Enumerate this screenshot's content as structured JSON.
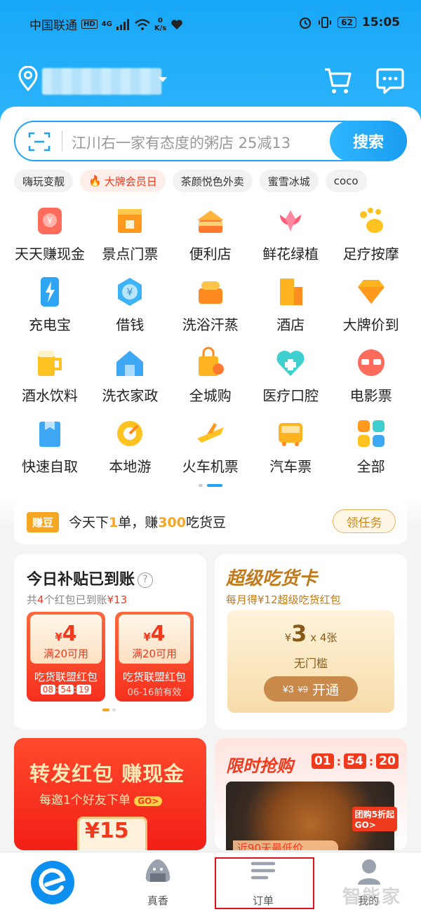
{
  "status": {
    "carrier": "中国联通",
    "hd": "HD",
    "network": "4G",
    "speed_value": "0",
    "speed_unit": "K/s",
    "battery": "62",
    "time": "15:05"
  },
  "search": {
    "placeholder": "江川右一家有态度的粥店 25减13",
    "button": "搜索"
  },
  "tags": [
    "嗨玩变靓",
    "大牌会员日",
    "茶颜悦色外卖",
    "蜜雪冰城",
    "coco"
  ],
  "grid": [
    {
      "label": "天天赚现金",
      "icon": "cash-icon"
    },
    {
      "label": "景点门票",
      "icon": "ticket-icon"
    },
    {
      "label": "便利店",
      "icon": "store-icon"
    },
    {
      "label": "鲜花绿植",
      "icon": "flower-icon"
    },
    {
      "label": "足疗按摩",
      "icon": "foot-icon"
    },
    {
      "label": "充电宝",
      "icon": "powerbank-icon"
    },
    {
      "label": "借钱",
      "icon": "loan-icon"
    },
    {
      "label": "洗浴汗蒸",
      "icon": "bath-icon"
    },
    {
      "label": "酒店",
      "icon": "hotel-icon"
    },
    {
      "label": "大牌价到",
      "icon": "diamond-icon"
    },
    {
      "label": "酒水饮料",
      "icon": "beer-icon"
    },
    {
      "label": "洗衣家政",
      "icon": "laundry-icon"
    },
    {
      "label": "全城购",
      "icon": "shopping-icon"
    },
    {
      "label": "医疗口腔",
      "icon": "medical-icon"
    },
    {
      "label": "电影票",
      "icon": "movie-icon"
    },
    {
      "label": "快速自取",
      "icon": "pickup-icon"
    },
    {
      "label": "本地游",
      "icon": "travel-icon"
    },
    {
      "label": "火车机票",
      "icon": "plane-icon"
    },
    {
      "label": "汽车票",
      "icon": "bus-icon"
    },
    {
      "label": "全部",
      "icon": "all-icon"
    }
  ],
  "task": {
    "badge": "赚豆",
    "t1": "今天下",
    "n1": "1",
    "t2": "单，赚",
    "n2": "300",
    "t3": "吃货豆",
    "button": "领任务"
  },
  "subsidy": {
    "title": "今日补贴已到账",
    "sub_prefix": "共",
    "sub_count": "4",
    "sub_mid": "个红包已到账",
    "sub_amount": "¥13",
    "packets": [
      {
        "currency": "¥",
        "amount": "4",
        "cond": "满20可用",
        "name": "吃货联盟红包",
        "h": "08",
        "m": "54",
        "s": "19"
      },
      {
        "currency": "¥",
        "amount": "4",
        "cond": "满20可用",
        "name": "吃货联盟红包",
        "expire": "06-16前有效"
      }
    ]
  },
  "supercard": {
    "title": "超级吃货卡",
    "sub": "每月得¥12超级吃货红包",
    "currency": "¥",
    "amount": "3",
    "times": "x",
    "count": "4张",
    "threshold": "无门槛",
    "btn_old": "¥9",
    "btn_label": "开通"
  },
  "share": {
    "title": "转发红包 赚现金",
    "sub": "每邀1个好友下单",
    "go": "GO>",
    "amount": "¥15"
  },
  "flash": {
    "title": "限时抢购",
    "h": "01",
    "m": "54",
    "s": "20",
    "badge": "团购5折起",
    "badge_go": "GO>",
    "banner": "近90天最低价"
  },
  "tabbar": [
    {
      "label": ""
    },
    {
      "label": "真香"
    },
    {
      "label": "订单"
    },
    {
      "label": "我的"
    }
  ],
  "watermark": "智能家",
  "colors": {
    "brand": "#1fa4f5",
    "accent": "#f03a1e",
    "gold": "#f5a623",
    "highlight": "#e0101a"
  }
}
